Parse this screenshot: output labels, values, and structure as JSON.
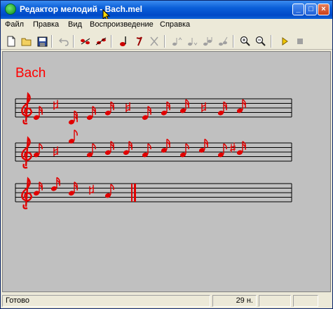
{
  "window": {
    "title": "Редактор мелодий - Bach.mel"
  },
  "menu": [
    {
      "label": "Файл"
    },
    {
      "label": "Правка"
    },
    {
      "label": "Вид"
    },
    {
      "label": "Воспроизведение"
    },
    {
      "label": "Справка"
    }
  ],
  "toolbar": [
    {
      "icon": "new-document-icon"
    },
    {
      "icon": "open-folder-icon"
    },
    {
      "icon": "save-icon"
    },
    {
      "icon": "undo-icon"
    },
    {
      "icon": "note-group-icon"
    },
    {
      "icon": "note-pair-icon"
    },
    {
      "icon": "note-red-icon"
    },
    {
      "icon": "rest-icon"
    },
    {
      "icon": "delete-note-icon"
    },
    {
      "icon": "raise-note-icon"
    },
    {
      "icon": "lower-note-icon"
    },
    {
      "icon": "duration-up-icon"
    },
    {
      "icon": "duration-down-icon"
    },
    {
      "icon": "zoom-in-icon"
    },
    {
      "icon": "zoom-out-icon"
    },
    {
      "icon": "play-icon"
    },
    {
      "icon": "stop-icon"
    }
  ],
  "score": {
    "title": "Bach",
    "note_color": "#e00000"
  },
  "status": {
    "text": "Готово",
    "note_count": "29 н."
  }
}
